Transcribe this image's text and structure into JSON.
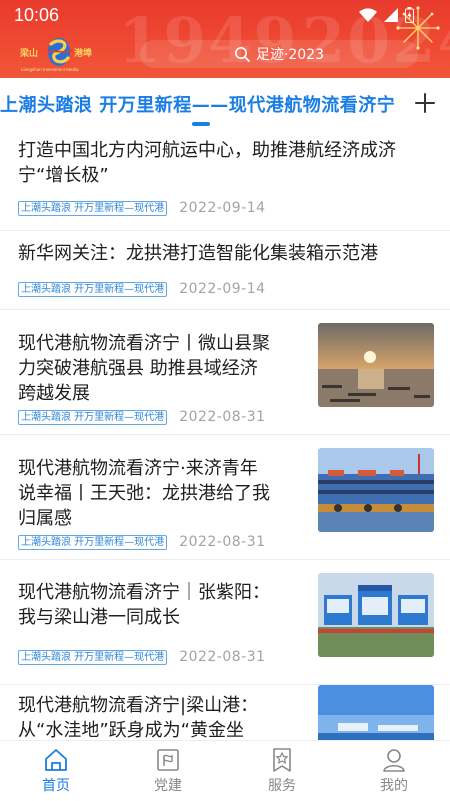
{
  "status_bar": {
    "time": "10:06"
  },
  "header": {
    "bg_year_left": "1949",
    "bg_year_right": "2024",
    "logo_cn_left": "梁山",
    "logo_cn_right": "港埠",
    "logo_subtitle": "Liangshan Investment Media",
    "search_placeholder": "足迹·2023",
    "accent_color": "#e83a2c"
  },
  "tabs": {
    "active_label": "上潮头踏浪 开万里新程——现代港航物流看济宁",
    "add_icon": "plus-icon"
  },
  "articles": [
    {
      "title_lines": [
        "打造中国北方内河航运中心，助推港航经济成济",
        "宁“增长极”"
      ],
      "tag": "上潮头踏浪 开万里新程—现代港",
      "date": "2022-09-14",
      "has_image": false
    },
    {
      "title_lines": [
        "新华网关注：龙拱港打造智能化集装箱示范港"
      ],
      "tag": "上潮头踏浪 开万里新程—现代港",
      "date": "2022-09-14",
      "has_image": false
    },
    {
      "title_lines": [
        "现代港航物流看济宁丨微山县聚",
        "力突破港航强县 助推县域经济",
        "跨越发展"
      ],
      "tag": "上潮头踏浪 开万里新程—现代港",
      "date": "2022-08-31",
      "has_image": true,
      "image": "sunset-lake-harbor"
    },
    {
      "title_lines": [
        "现代港航物流看济宁·来济青年",
        "说幸福丨王天弛：龙拱港给了我",
        "归属感"
      ],
      "tag": "上潮头踏浪 开万里新程—现代港",
      "date": "2022-08-31",
      "has_image": true,
      "image": "cargo-barges-port"
    },
    {
      "title_lines": [
        "现代港航物流看济宁｜张紫阳：",
        "我与梁山港一同成长"
      ],
      "tag": "上潮头踏浪 开万里新程—现代港",
      "date": "2022-08-31",
      "has_image": true,
      "image": "port-billboards"
    },
    {
      "title_lines": [
        "现代港航物流看济宁|梁山港：",
        "从“水洼地”跃身成为“黄金坐"
      ],
      "tag": "",
      "date": "",
      "has_image": true,
      "image": "port-blue-sky"
    }
  ],
  "bottom_nav": [
    {
      "label": "首页",
      "icon": "home-icon",
      "active": true
    },
    {
      "label": "党建",
      "icon": "party-flag-icon",
      "active": false
    },
    {
      "label": "服务",
      "icon": "service-star-icon",
      "active": false
    },
    {
      "label": "我的",
      "icon": "user-icon",
      "active": false
    }
  ],
  "colors": {
    "primary_blue": "#1a7ee6",
    "header_red": "#e83a2c",
    "tag_blue": "#2f86d9",
    "date_gray": "#a3a3a3"
  }
}
